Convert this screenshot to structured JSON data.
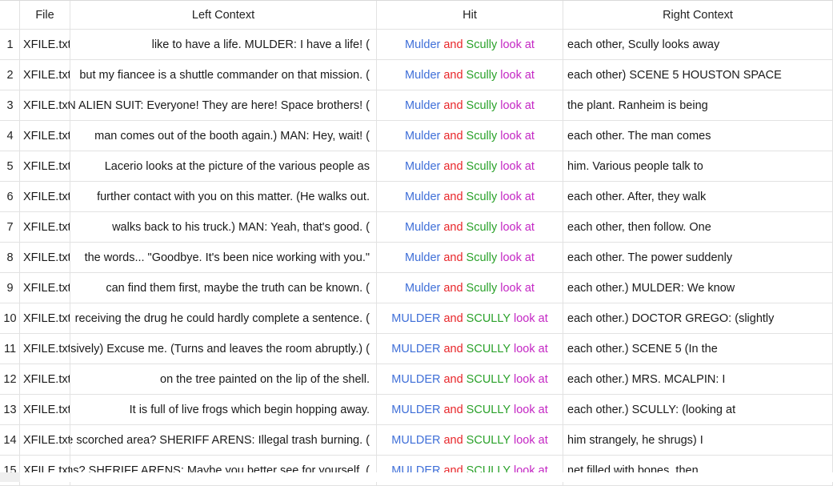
{
  "columns": {
    "num": "",
    "file": "File",
    "left": "Left Context",
    "hit": "Hit",
    "right": "Right Context"
  },
  "colors": {
    "hit_word_1": "#3f6fd8",
    "hit_word_2": "#e8262a",
    "hit_word_3": "#2aa12a",
    "hit_word_4": "#c427c4"
  },
  "rows": [
    {
      "num": "1",
      "file": "XFILE.txt",
      "left": "like to have a life. MULDER: I have a life! (",
      "hit": [
        "Mulder",
        "and",
        "Scully",
        "look at"
      ],
      "right": "each other, Scully looks away"
    },
    {
      "num": "2",
      "file": "XFILE.txt",
      "left": "but my fiancee is a shuttle commander on that mission. (",
      "hit": [
        "Mulder",
        "and",
        "Scully",
        "look at"
      ],
      "right": "each other) SCENE 5 HOUSTON SPACE"
    },
    {
      "num": "3",
      "file": "XFILE.txt",
      "left": "IN ALIEN SUIT: Everyone! They are here! Space brothers! (",
      "hit": [
        "Mulder",
        "and",
        "Scully",
        "look at"
      ],
      "right": "the plant. Ranheim is being"
    },
    {
      "num": "4",
      "file": "XFILE.txt",
      "left": "man comes out of the booth again.) MAN: Hey, wait! (",
      "hit": [
        "Mulder",
        "and",
        "Scully",
        "look at"
      ],
      "right": "each other. The man comes"
    },
    {
      "num": "5",
      "file": "XFILE.txt",
      "left": "Lacerio looks at the picture of the various people as",
      "hit": [
        "Mulder",
        "and",
        "Scully",
        "look at"
      ],
      "right": "him. Various people talk to"
    },
    {
      "num": "6",
      "file": "XFILE.txt",
      "left": "further contact with you on this matter. (He walks out.",
      "hit": [
        "Mulder",
        "and",
        "Scully",
        "look at"
      ],
      "right": "each other. After, they walk"
    },
    {
      "num": "7",
      "file": "XFILE.txt",
      "left": "walks back to his truck.) MAN: Yeah, that's good. (",
      "hit": [
        "Mulder",
        "and",
        "Scully",
        "look at"
      ],
      "right": "each other, then follow. One"
    },
    {
      "num": "8",
      "file": "XFILE.txt",
      "left": "the words... \"Goodbye. It's been nice working with you.\"",
      "hit": [
        "Mulder",
        "and",
        "Scully",
        "look at"
      ],
      "right": "each other. The power suddenly"
    },
    {
      "num": "9",
      "file": "XFILE.txt",
      "left": "can find them first, maybe the truth can be known. (",
      "hit": [
        "Mulder",
        "and",
        "Scully",
        "look at"
      ],
      "right": "each other.) MULDER: We know"
    },
    {
      "num": "10",
      "file": "XFILE.txt",
      "left": "receiving the drug he could hardly complete a sentence. (",
      "hit": [
        "MULDER",
        "and",
        "SCULLY",
        "look at"
      ],
      "right": "each other.) DOCTOR GREGO: (slightly"
    },
    {
      "num": "11",
      "file": "XFILE.txt",
      "left": "sively) Excuse me. (Turns and leaves the room abruptly.) (",
      "hit": [
        "MULDER",
        "and",
        "SCULLY",
        "look at"
      ],
      "right": "each other.) SCENE 5 (In the"
    },
    {
      "num": "12",
      "file": "XFILE.txt",
      "left": "on the tree painted on the lip of the shell.",
      "hit": [
        "MULDER",
        "and",
        "SCULLY",
        "look at"
      ],
      "right": "each other.) MRS. MCALPIN: I"
    },
    {
      "num": "13",
      "file": "XFILE.txt",
      "left": "It is full of live frogs which begin hopping away.",
      "hit": [
        "MULDER",
        "and",
        "SCULLY",
        "look at"
      ],
      "right": "each other.) SCULLY: (looking at"
    },
    {
      "num": "14",
      "file": "XFILE.txt",
      "left": "he scorched area? SHERIFF ARENS: Illegal trash burning. (",
      "hit": [
        "MULDER",
        "and",
        "SCULLY",
        "look at"
      ],
      "right": "him strangely, he shrugs) I"
    },
    {
      "num": "15",
      "file": "XFILE.txt",
      "left": "rns? SHERIFF ARENS: Maybe you better see for yourself. (",
      "hit": [
        "MULDER",
        "and",
        "SCULLY",
        "look at"
      ],
      "right": "net filled with bones, then"
    }
  ]
}
